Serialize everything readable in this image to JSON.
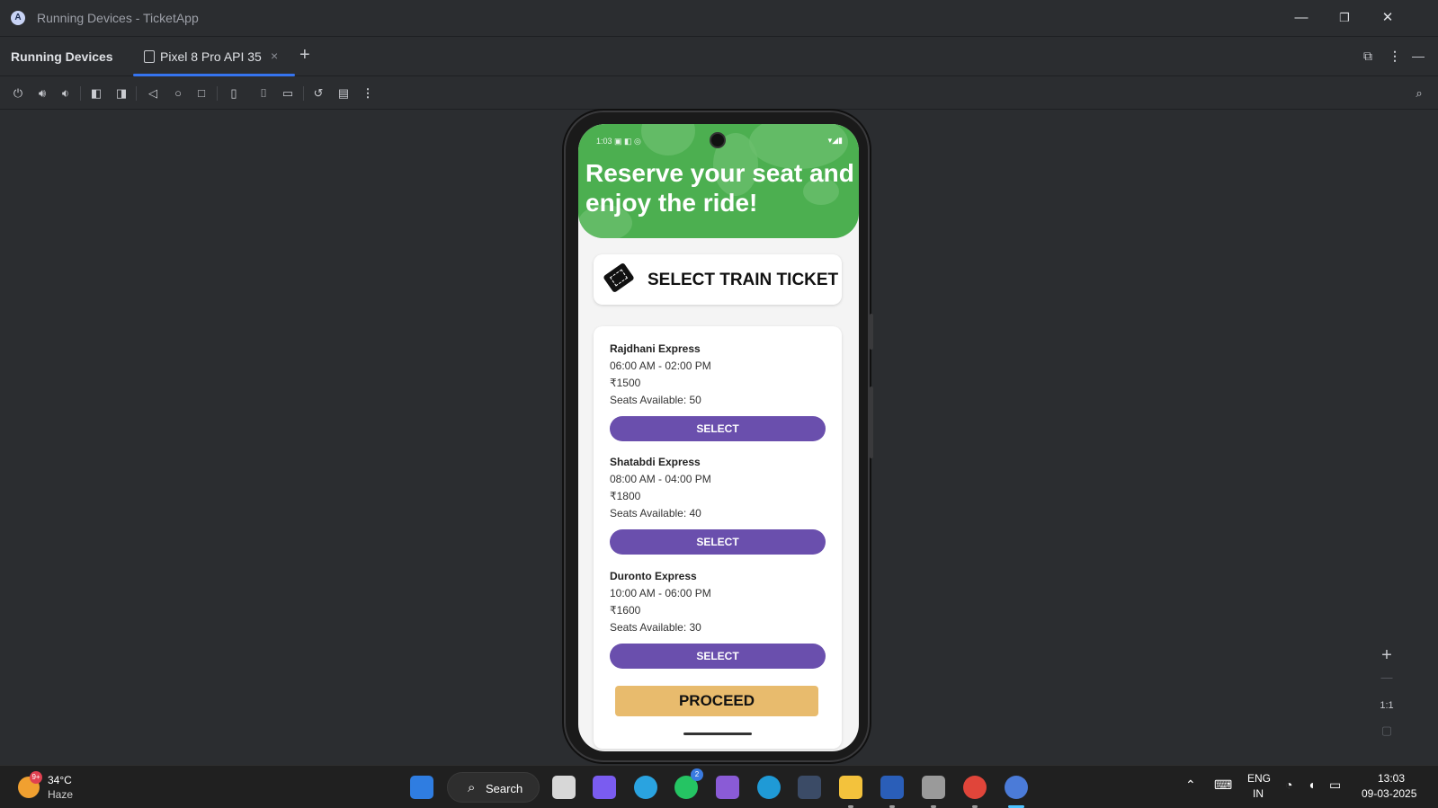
{
  "window": {
    "title": "Running Devices - TicketApp",
    "logo_letter": "A",
    "minimize": "—",
    "restore": "❐",
    "close": "✕"
  },
  "tabs": {
    "panel_label": "Running Devices",
    "device_tab": "Pixel 8 Pro API 35",
    "close": "×",
    "add": "+"
  },
  "toolbar": {
    "icons": [
      "power-icon",
      "volume-up-icon",
      "volume-down-icon",
      "rotate-left-icon",
      "rotate-right-icon",
      "back-icon",
      "home-icon",
      "overview-icon",
      "device-manager-icon",
      "screenshot-icon",
      "screen-record-icon",
      "reset-icon",
      "snapshot-icon",
      "more-icon"
    ]
  },
  "phone": {
    "status_time": "1:03",
    "status_icons_left": "▣ ◧ ◎",
    "status_icons_right": "▾◢▮",
    "hero_text": "Reserve your seat and enjoy the ride!",
    "select_title": "SELECT TRAIN TICKET",
    "trains": [
      {
        "name": "Rajdhani Express",
        "time": "06:00 AM - 02:00 PM",
        "price": "₹1500",
        "seats": "Seats Available: 50",
        "button": "SELECT"
      },
      {
        "name": "Shatabdi Express",
        "time": "08:00 AM - 04:00 PM",
        "price": "₹1800",
        "seats": "Seats Available: 40",
        "button": "SELECT"
      },
      {
        "name": "Duronto Express",
        "time": "10:00 AM - 06:00 PM",
        "price": "₹1600",
        "seats": "Seats Available: 30",
        "button": "SELECT"
      }
    ],
    "proceed": "PROCEED"
  },
  "zoom_controls": {
    "zoom_in": "+",
    "zoom_out": "—",
    "actual_size": "1:1"
  },
  "taskbar": {
    "weather_badge": "9+",
    "temperature": "34°C",
    "condition": "Haze",
    "search": "Search",
    "whatsapp_badge": "2",
    "language": "ENG",
    "region": "IN",
    "time": "13:03",
    "date": "09-03-2025"
  },
  "colors": {
    "header_green": "#4caf50",
    "select_purple": "#6a4fad",
    "proceed_gold": "#e8bb6d",
    "tab_accent": "#3574f0"
  }
}
